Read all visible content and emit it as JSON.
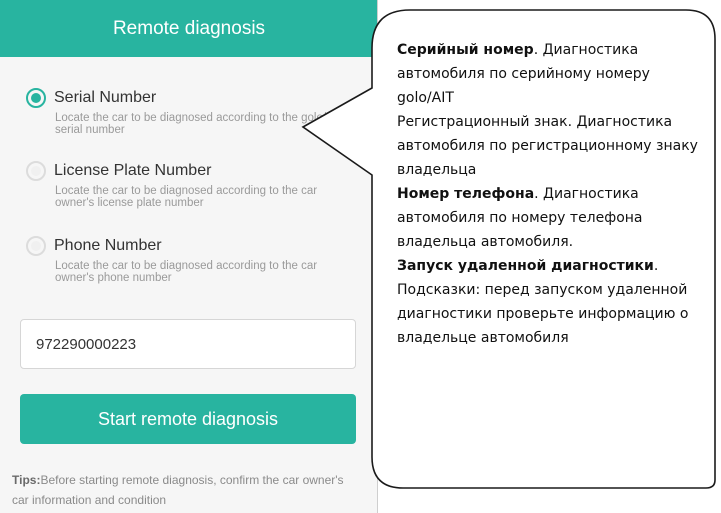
{
  "header": {
    "title": "Remote diagnosis"
  },
  "options": [
    {
      "label": "Serial Number",
      "desc": "Locate the car to be diagnosed according to the golo/AIT serial number",
      "checked": true
    },
    {
      "label": "License Plate Number",
      "desc": "Locate the car to be diagnosed according to the car owner's license plate number",
      "checked": false
    },
    {
      "label": "Phone Number",
      "desc": "Locate the car to be diagnosed according to the car owner's phone number",
      "checked": false
    }
  ],
  "input": {
    "value": "972290000223"
  },
  "start_button": {
    "label": "Start remote diagnosis"
  },
  "tips": {
    "prefix": "Tips:",
    "text": "Before starting remote diagnosis, confirm the car owner's car information and condition"
  },
  "callout": {
    "serial_bold": "Серийный номер",
    "serial_text": ". Диагностика автомобиля по серийному номеру golo/AIT",
    "plate_text": "Регистрационный знак. Диагностика автомобиля по регистрационному знаку владельца",
    "phone_bold": "Номер телефона",
    "phone_text": ". Диагностика автомобиля по номеру телефона владельца автомобиля.",
    "start_bold": "Запуск удаленной диагностики",
    "start_text": ". Подсказки: перед запуском удаленной диагностики проверьте информацию о владельце автомобиля"
  },
  "colors": {
    "accent": "#28b4a0"
  }
}
